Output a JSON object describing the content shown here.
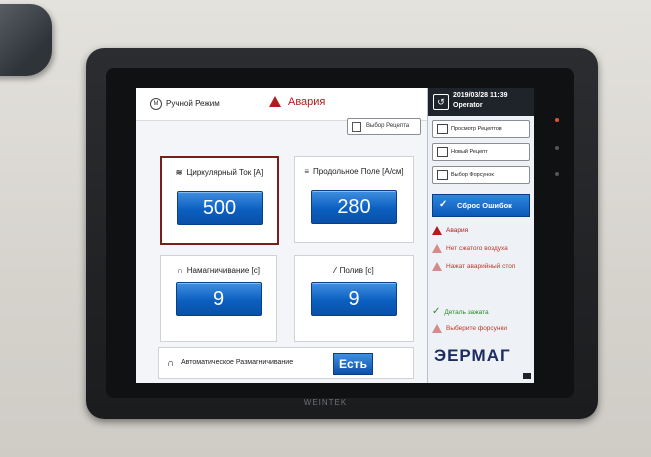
{
  "header": {
    "mode_label": "Ручной Режим",
    "alarm_label": "Авария",
    "recipe_select_label": "Выбор Рецепта"
  },
  "cards": [
    {
      "title": "Циркулярный Ток [А]",
      "value": "500"
    },
    {
      "title": "Продольное Поле [А/см]",
      "value": "280"
    },
    {
      "title": "Намагничивание [с]",
      "value": "9"
    },
    {
      "title": "Полив [с]",
      "value": "9"
    }
  ],
  "auto_demag": {
    "label": "Автоматическое Размагничивание",
    "value": "Есть"
  },
  "sidebar": {
    "datetime": "2019/03/28 11:39",
    "user": "Operator",
    "buttons": [
      "Просмотр Рецептов",
      "Новый Рецепт",
      "Выбор Форсунок"
    ],
    "reset_label": "Сброс Ошибок",
    "messages": [
      "Авария",
      "Нет сжатого воздуха",
      "Нажат аварийный стоп",
      "Деталь зажата",
      "Выберите форсунки"
    ],
    "logo": "ЭЕРМАГ"
  },
  "device": {
    "brand": "WEINTEK"
  }
}
